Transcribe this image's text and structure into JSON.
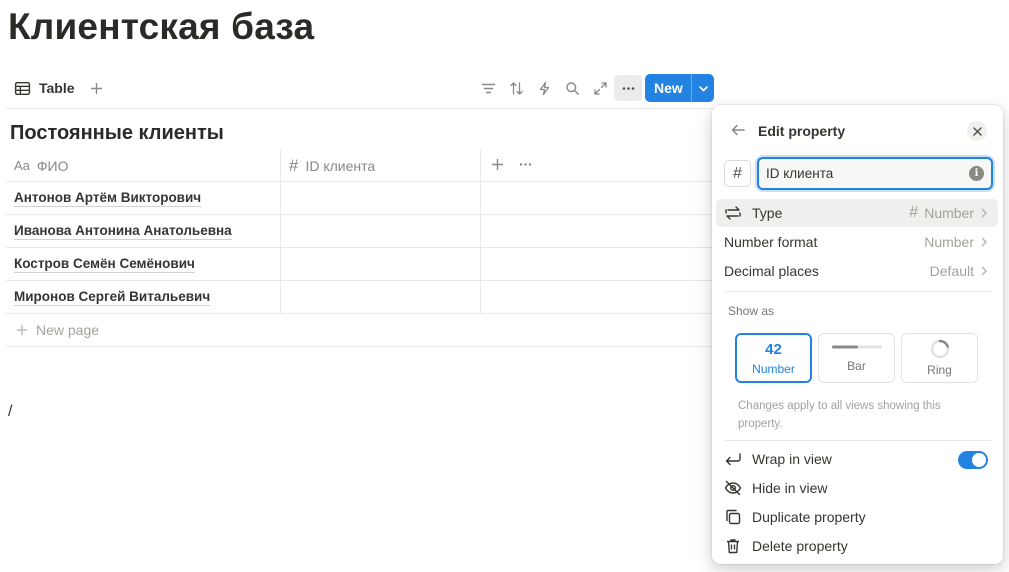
{
  "page": {
    "title": "Клиентская база"
  },
  "toolbar": {
    "view_tab_label": "Table",
    "new_label": "New"
  },
  "database": {
    "title": "Постоянные клиенты",
    "columns": [
      {
        "icon_text": "Aa",
        "label": "ФИО"
      },
      {
        "icon_text": "#",
        "label": "ID клиента"
      }
    ],
    "rows": [
      {
        "name": "Антонов Артём Викторович",
        "id": ""
      },
      {
        "name": "Иванова Антонина Анатольевна",
        "id": ""
      },
      {
        "name": "Костров Семён Семёнович",
        "id": ""
      },
      {
        "name": "Миронов Сергей Витальевич",
        "id": ""
      }
    ],
    "new_page_label": "New page"
  },
  "editor_text": "/",
  "panel": {
    "title": "Edit property",
    "icon_glyph": "#",
    "property_name": "ID клиента",
    "info_glyph": "i",
    "type": {
      "label": "Type",
      "value_icon": "#",
      "value": "Number"
    },
    "number_format": {
      "label": "Number format",
      "value": "Number"
    },
    "decimal_places": {
      "label": "Decimal places",
      "value": "Default"
    },
    "show_as": {
      "label": "Show as",
      "options": [
        {
          "preview": "42",
          "label": "Number",
          "selected": true
        },
        {
          "label": "Bar",
          "selected": false
        },
        {
          "label": "Ring",
          "selected": false
        }
      ],
      "note": "Changes apply to all views showing this property."
    },
    "actions": {
      "wrap_in_view": {
        "label": "Wrap in view",
        "enabled": true
      },
      "hide_in_view": "Hide in view",
      "duplicate": "Duplicate property",
      "delete": "Delete property"
    }
  },
  "colors": {
    "accent": "#2383e2",
    "text": "#37352f",
    "muted": "#8b8984"
  }
}
